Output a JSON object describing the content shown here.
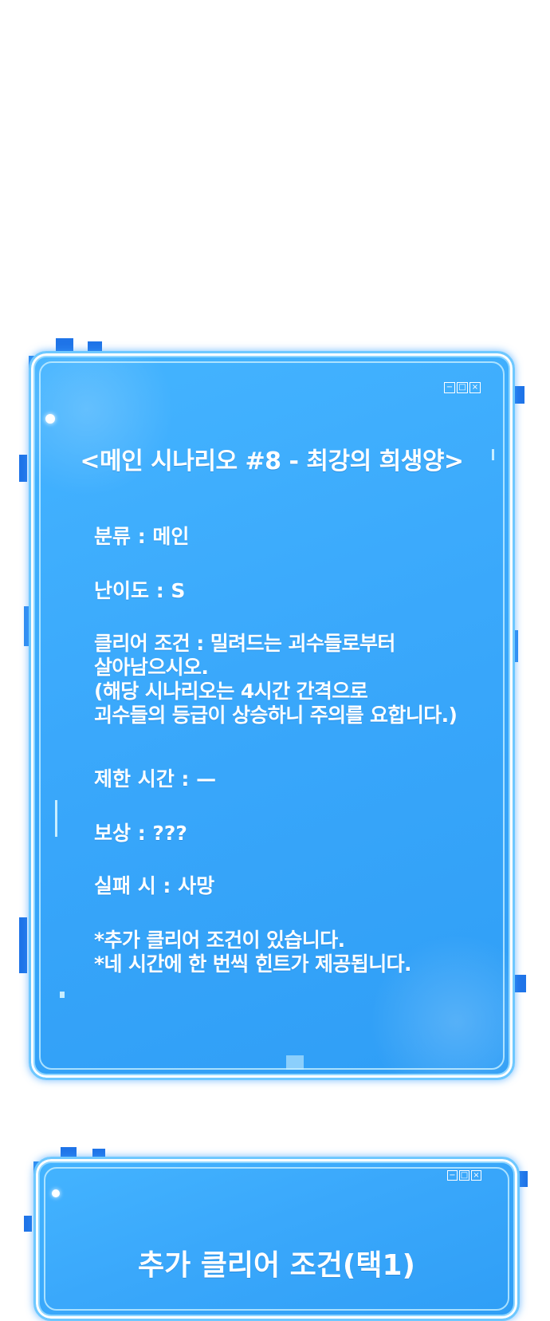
{
  "panel1": {
    "title": "<메인 시나리오 #8 - 최강의 희생양>",
    "controls": [
      "minimize-icon",
      "maximize-icon",
      "close-icon"
    ],
    "lines": [
      "분류 : 메인",
      "난이도 : S",
      "클리어 조건 : 밀려드는 괴수들로부터\n살아남으시오.\n(해당 시나리오는 4시간 간격으로\n괴수들의 등급이 상승하니 주의를 요합니다.)",
      "제한 시간 : —",
      "보상 : ???",
      "실패 시 : 사망",
      "*추가 클리어 조건이 있습니다.\n*네 시간에 한 번씩 힌트가 제공됩니다."
    ]
  },
  "panel2": {
    "title": "추가 클리어 조건(택1)",
    "controls": [
      "minimize-icon",
      "maximize-icon",
      "close-icon"
    ]
  },
  "colors": {
    "panel_fill": "#3aa8fb",
    "panel_border": "#6ec8ff",
    "deco_blue": "#1f74e8",
    "text": "#ffffff"
  }
}
